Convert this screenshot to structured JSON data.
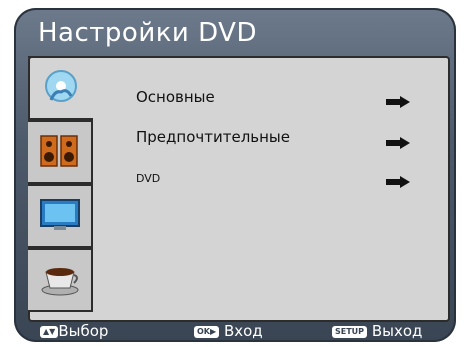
{
  "header": {
    "title": "Настройки DVD"
  },
  "sidebar": {
    "items": [
      {
        "icon": "disc-person-icon"
      },
      {
        "icon": "speakers-icon"
      },
      {
        "icon": "tv-screen-icon"
      },
      {
        "icon": "coffee-cup-icon"
      }
    ]
  },
  "menu": {
    "items": [
      {
        "label": "Основные"
      },
      {
        "label": "Предпочтительные"
      },
      {
        "label": "DVD"
      }
    ]
  },
  "footer": {
    "select_key": "▲▼",
    "select_label": "Выбор",
    "enter_key": "OK▶",
    "enter_label": "Вход",
    "exit_key": "SETUP",
    "exit_label": "Выход"
  }
}
